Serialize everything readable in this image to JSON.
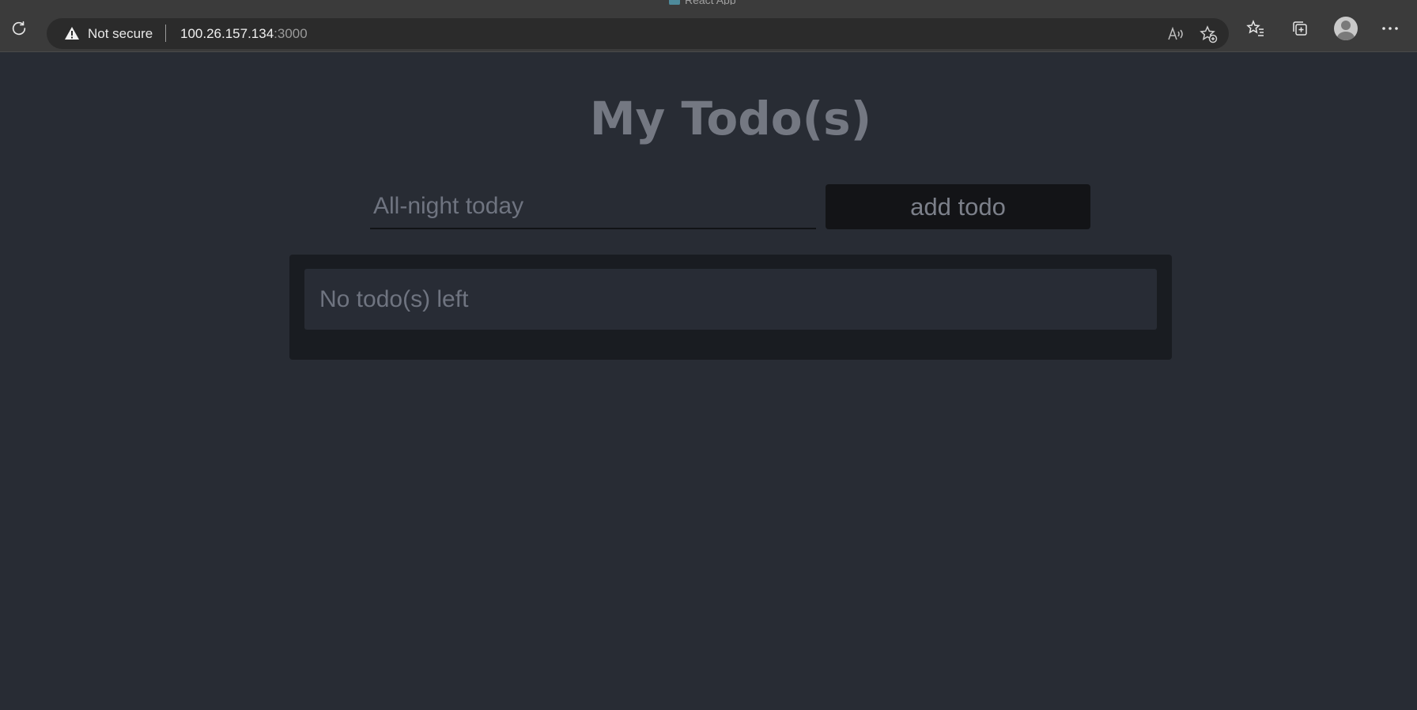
{
  "browser": {
    "tab_title": "React App",
    "security_label": "Not secure",
    "url_host": "100.26.157.134",
    "url_port": ":3000"
  },
  "app": {
    "title": "My Todo(s)",
    "input_placeholder": "All-night today",
    "add_button_label": "add todo",
    "empty_message": "No todo(s) left"
  }
}
